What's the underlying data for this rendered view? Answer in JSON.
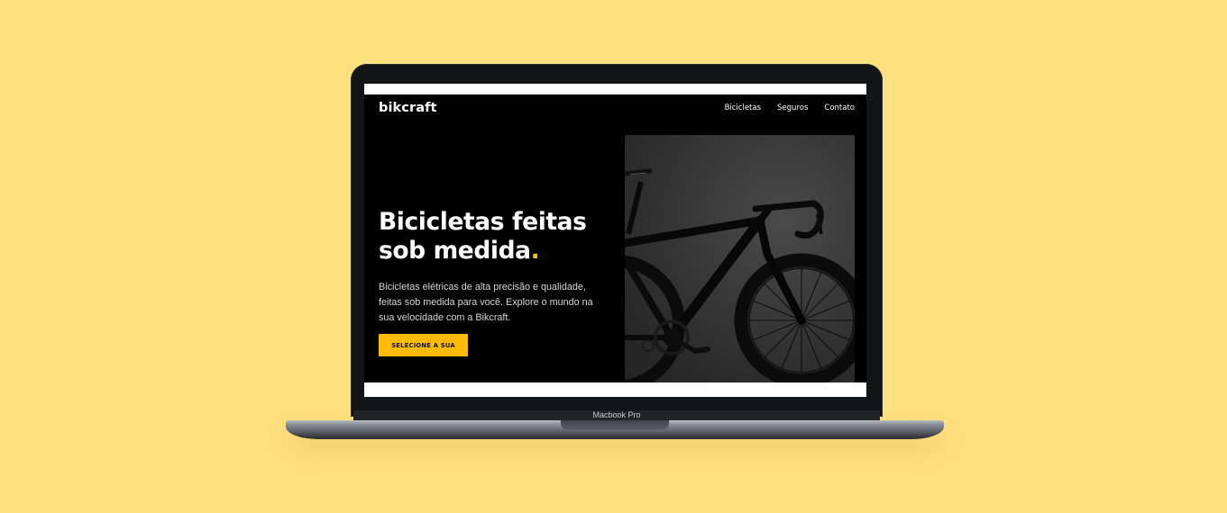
{
  "device": {
    "label": "Macbook Pro"
  },
  "site": {
    "brand": "bikcraft",
    "nav": [
      {
        "label": "Bicicletas"
      },
      {
        "label": "Seguros"
      },
      {
        "label": "Contato"
      }
    ],
    "hero": {
      "title_line1": "Bicicletas feitas",
      "title_line2": "sob medida",
      "title_dot": ".",
      "text": "Bicicletas elétricas de alta precisão e qualidade, feitas sob medida para você. Explore o mundo na sua velocidade com a Bikcraft.",
      "cta_label": "SELECIONE A SUA",
      "image": "black-road-bike-photo"
    }
  },
  "colors": {
    "background": "#FFE07F",
    "accent": "#FFBB00",
    "site_background": "#000000",
    "text_primary": "#FFFFFF",
    "text_secondary": "#D7D7D7",
    "laptop_bezel": "#121416"
  }
}
